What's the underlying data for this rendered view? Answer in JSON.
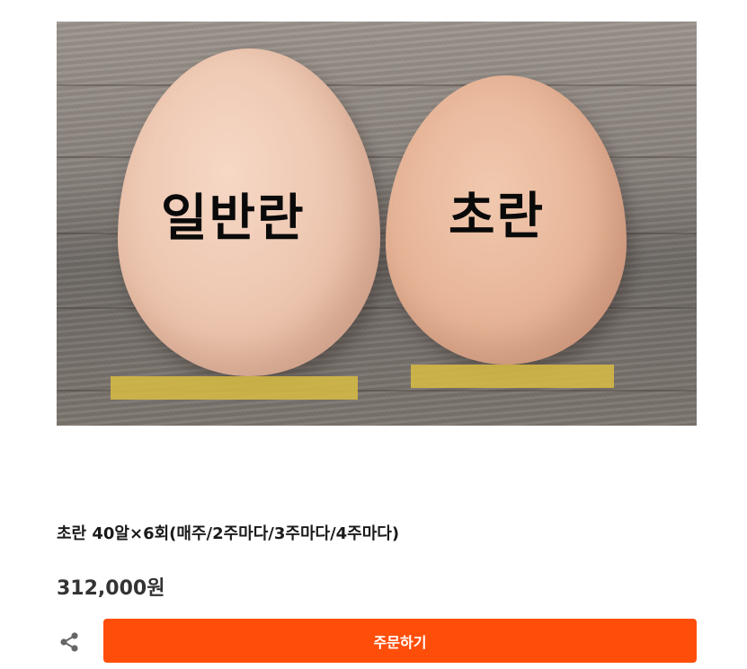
{
  "product": {
    "image": {
      "label_left": "일반란",
      "label_right": "초란"
    },
    "title": "초란 40알×6회(매주/2주마다/3주마다/4주마다)",
    "price": "312,000원"
  },
  "actions": {
    "share_icon": "share-icon",
    "order_label": "주문하기"
  },
  "colors": {
    "accent": "#ff4e0a",
    "tape": "#d6ba44"
  }
}
